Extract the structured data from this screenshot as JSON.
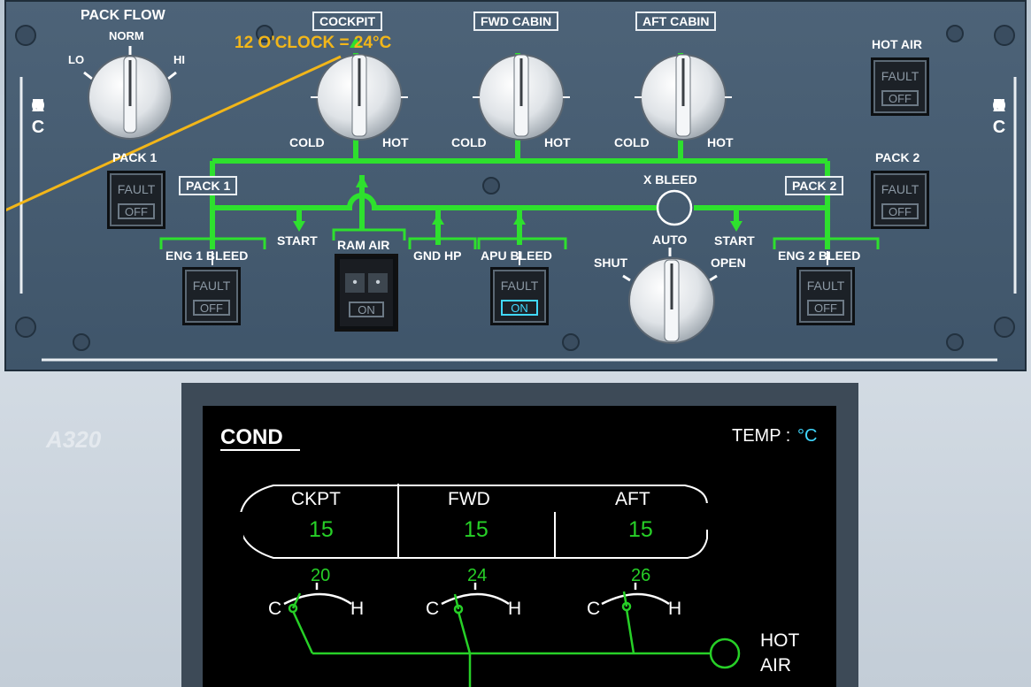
{
  "panel": {
    "pack_flow": {
      "title": "PACK FLOW",
      "lo": "LO",
      "norm": "NORM",
      "hi": "HI"
    },
    "annotation": "12 O'CLOCK = 24°C",
    "zones": [
      {
        "label": "COCKPIT",
        "cold": "COLD",
        "hot": "HOT"
      },
      {
        "label": "FWD CABIN",
        "cold": "COLD",
        "hot": "HOT"
      },
      {
        "label": "AFT CABIN",
        "cold": "COLD",
        "hot": "HOT"
      }
    ],
    "hot_air": {
      "label": "HOT AIR",
      "fault": "FAULT",
      "state": "OFF"
    },
    "side_label": [
      "A",
      "I",
      "R",
      "C",
      "O",
      "N",
      "D"
    ],
    "pack1": {
      "label": "PACK 1",
      "box_label": "PACK 1",
      "fault": "FAULT",
      "state": "OFF"
    },
    "pack2": {
      "label": "PACK 2",
      "box_label": "PACK 2",
      "fault": "FAULT",
      "state": "OFF"
    },
    "x_bleed": {
      "label": "X BLEED",
      "shut": "SHUT",
      "auto": "AUTO",
      "open": "OPEN"
    },
    "start_left": "START",
    "start_right": "START",
    "ram_air": {
      "label": "RAM AIR",
      "state": "ON",
      "dot": "•"
    },
    "gnd_hp": "GND HP",
    "eng1_bleed": {
      "label": "ENG 1 BLEED",
      "fault": "FAULT",
      "state": "OFF"
    },
    "apu_bleed": {
      "label": "APU BLEED",
      "fault": "FAULT",
      "state": "ON"
    },
    "eng2_bleed": {
      "label": "ENG 2 BLEED",
      "fault": "FAULT",
      "state": "OFF"
    },
    "colors": {
      "duct": "#2ee02e",
      "annotation": "#f2b619",
      "on_light": "#41d8ff"
    }
  },
  "ecam": {
    "title": "COND",
    "temp_label": "TEMP :",
    "temp_unit": "°C",
    "zones": [
      {
        "name": "CKPT",
        "temp": "15",
        "target": "20",
        "c": "C",
        "h": "H"
      },
      {
        "name": "FWD",
        "temp": "15",
        "target": "24",
        "c": "C",
        "h": "H"
      },
      {
        "name": "AFT",
        "temp": "15",
        "target": "26",
        "c": "C",
        "h": "H"
      }
    ],
    "hot_air_line1": "HOT",
    "hot_air_line2": "AIR",
    "watermark": "A320"
  }
}
